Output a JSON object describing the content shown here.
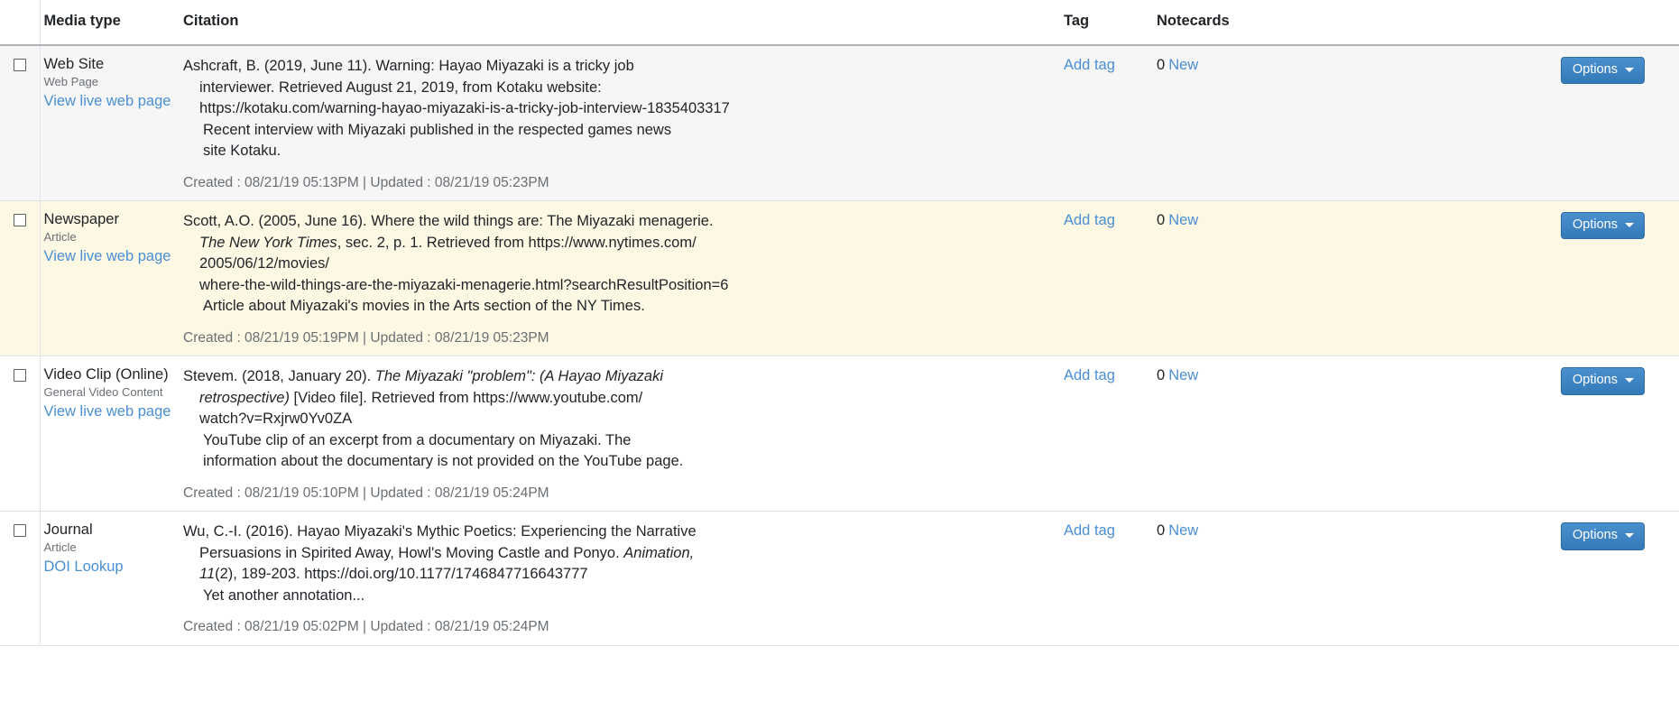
{
  "colors": {
    "link": "#4a8fd4",
    "button": "#3b82c4",
    "row_shaded": "#f6f6f6",
    "row_highlight": "#fdf8e3"
  },
  "table": {
    "columns": {
      "select": "",
      "media_type": "Media type",
      "citation": "Citation",
      "tag": "Tag",
      "notecards": "Notecards"
    },
    "options_label": "Options",
    "add_tag_label": "Add tag",
    "new_label": "New",
    "rows": [
      {
        "row_style": "row-shaded",
        "media_type": "Web Site",
        "media_subtype": "Web Page",
        "media_link": "View live web page",
        "citation_lines": [
          {
            "text": "Ashcraft, B. (2019, June 11). Warning: Hayao Miyazaki is a tricky job",
            "indent": "none",
            "italic": false
          },
          {
            "text": "interviewer. Retrieved August 21, 2019, from Kotaku website:",
            "indent": "indent",
            "italic": false
          },
          {
            "text": "https://kotaku.com/warning-hayao-miyazaki-is-a-tricky-job-interview-1835403317",
            "indent": "indent",
            "italic": false
          }
        ],
        "annotation_lines": [
          "Recent interview with Miyazaki published in the respected games news",
          "site Kotaku."
        ],
        "created": "Created : 08/21/19 05:13PM | Updated : 08/21/19 05:23PM",
        "tag": "Add tag",
        "notecard_count": "0",
        "notecard_new": "New",
        "options": "Options"
      },
      {
        "row_style": "row-warn",
        "media_type": "Newspaper",
        "media_subtype": "Article",
        "media_link": "View live web page",
        "citation_lines": [
          {
            "text": "Scott, A.O. (2005, June 16). Where the wild things are: The Miyazaki menagerie.",
            "indent": "none",
            "italic": false
          },
          {
            "text": "The New York Times",
            "indent": "indent",
            "italic": true,
            "suffix": ", sec. 2, p. 1. Retrieved from https://www.nytimes.com/"
          },
          {
            "text": "2005/06/12/movies/",
            "indent": "indent",
            "italic": false
          },
          {
            "text": "where-the-wild-things-are-the-miyazaki-menagerie.html?searchResultPosition=6",
            "indent": "indent",
            "italic": false
          }
        ],
        "annotation_lines": [
          "Article about Miyazaki's movies in the Arts section of the NY Times."
        ],
        "created": "Created : 08/21/19 05:19PM | Updated : 08/21/19 05:23PM",
        "tag": "Add tag",
        "notecard_count": "0",
        "notecard_new": "New",
        "options": "Options"
      },
      {
        "row_style": "row-plain",
        "media_type": "Video Clip (Online)",
        "media_subtype": "General Video Content",
        "media_link": "View live web page",
        "citation_lines": [
          {
            "text": "Stevem. (2018, January 20). ",
            "indent": "none",
            "italic": false,
            "italic_tail": "The Miyazaki \"problem\": (A Hayao Miyazaki"
          },
          {
            "text": "retrospective)",
            "indent": "indent",
            "italic": true,
            "suffix": " [Video file]. Retrieved from https://www.youtube.com/"
          },
          {
            "text": "watch?v=Rxjrw0Yv0ZA",
            "indent": "indent",
            "italic": false
          }
        ],
        "annotation_lines": [
          "YouTube clip of an excerpt from a documentary on Miyazaki. The",
          "information about the documentary is not provided on the YouTube page."
        ],
        "created": "Created : 08/21/19 05:10PM | Updated : 08/21/19 05:24PM",
        "tag": "Add tag",
        "notecard_count": "0",
        "notecard_new": "New",
        "options": "Options"
      },
      {
        "row_style": "row-plain",
        "media_type": "Journal",
        "media_subtype": "Article",
        "media_link": "DOI Lookup",
        "citation_lines": [
          {
            "text": "Wu, C.-I. (2016). Hayao Miyazaki's Mythic Poetics: Experiencing the Narrative",
            "indent": "none",
            "italic": false
          },
          {
            "text": "Persuasions in Spirited Away, Howl's Moving Castle and Ponyo. ",
            "indent": "indent",
            "italic": false,
            "italic_tail": "Animation,"
          },
          {
            "text": "11",
            "indent": "indent",
            "italic": true,
            "suffix": "(2), 189-203. https://doi.org/10.1177/1746847716643777"
          }
        ],
        "annotation_lines": [
          "Yet another annotation..."
        ],
        "created": "Created : 08/21/19 05:02PM | Updated : 08/21/19 05:24PM",
        "tag": "Add tag",
        "notecard_count": "0",
        "notecard_new": "New",
        "options": "Options"
      }
    ]
  }
}
